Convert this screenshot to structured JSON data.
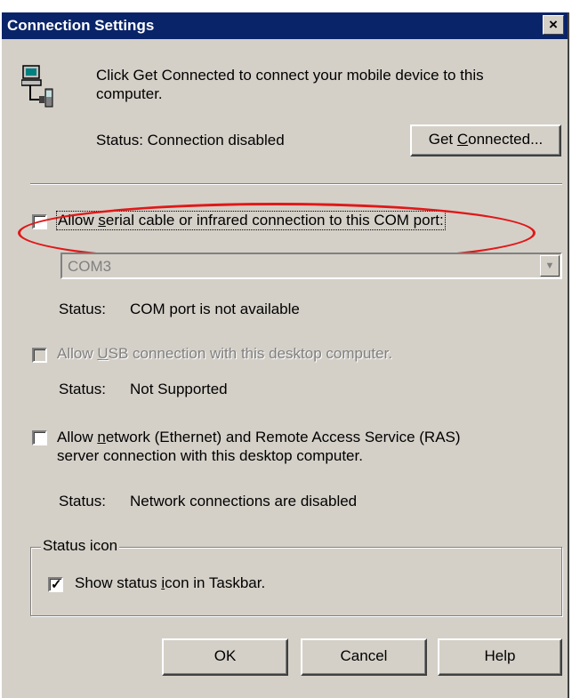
{
  "window": {
    "title": "Connection Settings",
    "close_glyph": "×"
  },
  "device_icon": "computer-and-mobile-device-icon",
  "intro": {
    "text_line1": "Click Get Connected to connect your mobile device to this",
    "text_line2": "computer.",
    "status": "Status: Connection disabled",
    "get_connected_pre": "Get ",
    "get_connected_accel": "C",
    "get_connected_post": "onnected..."
  },
  "com_port": {
    "checked": false,
    "label_pre": "Allow ",
    "label_accel": "s",
    "label_post": "erial cable or infrared connection to this COM port:",
    "selected_value": "COM3",
    "status_label": "Status:",
    "status_value": "COM port is not available"
  },
  "usb": {
    "checked": false,
    "enabled": false,
    "label_pre": "Allow ",
    "label_accel": "U",
    "label_post": "SB connection with this desktop computer.",
    "status_label": "Status:",
    "status_value": "Not Supported"
  },
  "network": {
    "checked": false,
    "label_pre": "Allow ",
    "label_accel": "n",
    "label_post_line1": "etwork (Ethernet) and Remote Access Service (RAS)",
    "label_line2": "server connection with this desktop computer.",
    "status_label": "Status:",
    "status_value": "Network connections are disabled"
  },
  "status_icon_group": {
    "legend": "Status icon",
    "checked": true,
    "label_pre": "Show status ",
    "label_accel": "i",
    "label_post": "con in Taskbar."
  },
  "buttons": {
    "ok": "OK",
    "cancel": "Cancel",
    "help": "Help"
  },
  "colors": {
    "titlebar": "#0a246a",
    "dialog_bg": "#d4d0c8",
    "annotation_ellipse": "#e01818"
  }
}
